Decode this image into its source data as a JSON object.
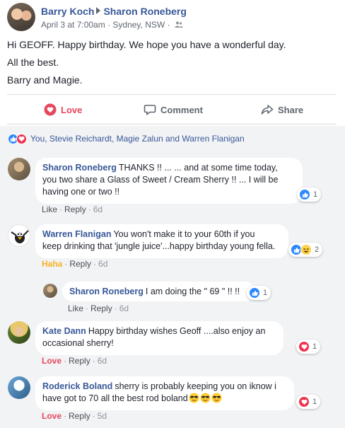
{
  "post": {
    "author": "Barry Koch",
    "target": "Sharon Roneberg",
    "timestamp": "April 3 at 7:00am",
    "location": "Sydney, NSW",
    "body": [
      "Hi GEOFF. Happy birthday. We hope you have a wonderful day.",
      "All the best.",
      "Barry and Magie."
    ]
  },
  "actions": {
    "love": "Love",
    "comment": "Comment",
    "share": "Share"
  },
  "reactions_summary": "You, Stevie Reichardt, Magie Zalun and Warren Flanigan",
  "comments": [
    {
      "author": "Sharon Roneberg",
      "text_lines": [
        "THANKS !! ... ... and at some time today,",
        "you two share a Glass of Sweet / Cream Sherry !! ... I will be",
        "having one or two !!"
      ],
      "reaction_label": "Like",
      "reply": "Reply",
      "time": "6d",
      "badge_count": "1"
    },
    {
      "author": "Warren Flanigan",
      "text_lines": [
        "You won't make it to your 60th if you",
        "keep drinking that 'jungle juice'...happy birthday young fella."
      ],
      "reaction_label": "Haha",
      "reply": "Reply",
      "time": "6d",
      "badge_count": "2"
    },
    {
      "author": "Sharon Roneberg",
      "text_lines": [
        "I am doing the \" 69 \" !! !!"
      ],
      "reaction_label": "Like",
      "reply": "Reply",
      "time": "6d",
      "badge_count": "1"
    },
    {
      "author": "Kate Dann",
      "text_lines": [
        "Happy birthday wishes Geoff ....also enjoy an",
        "occasional sherry!"
      ],
      "reaction_label": "Love",
      "reply": "Reply",
      "time": "6d",
      "badge_count": "1"
    },
    {
      "author": "Roderick Boland",
      "text_lines": [
        "sherry is probably keeping you on iknow i",
        "have got to 70 all the best rod boland"
      ],
      "reaction_label": "Love",
      "reply": "Reply",
      "time": "5d",
      "badge_count": "1",
      "emojis": [
        "sunglasses-face-icon",
        "sunglasses-face-icon",
        "sunglasses-face-icon"
      ]
    }
  ],
  "colors": {
    "link": "#385898",
    "love": "#e8465d",
    "haha": "#f7b125",
    "like": "#2d88ff",
    "bg": "#f2f3f5"
  }
}
